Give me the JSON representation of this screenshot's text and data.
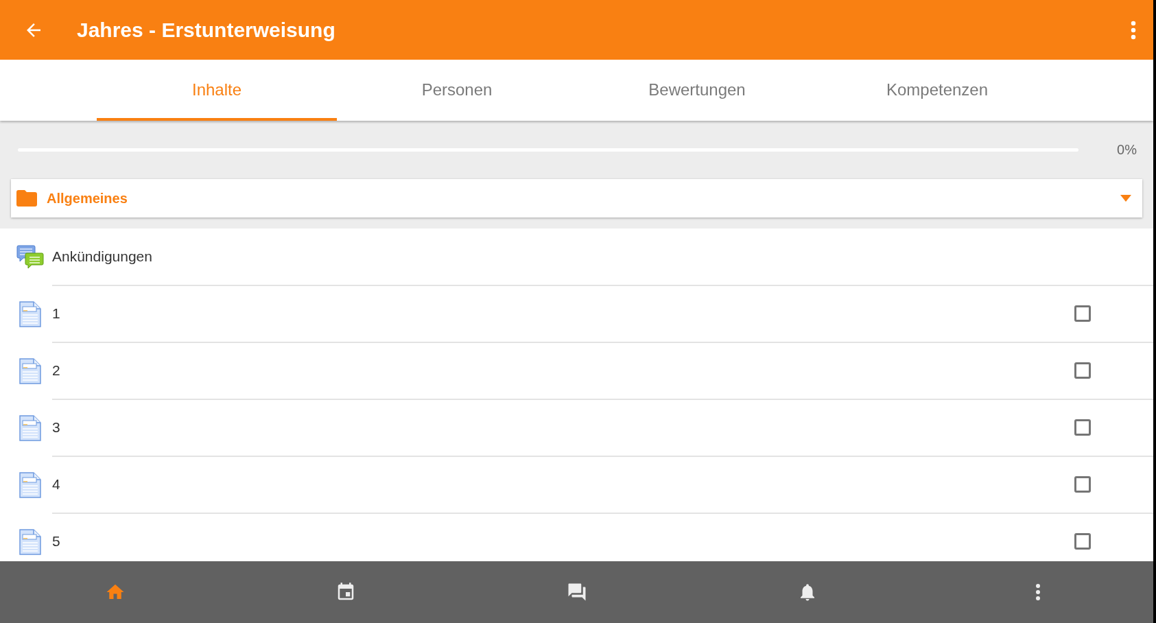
{
  "app_bar": {
    "title": "Jahres - Erstunterweisung"
  },
  "tabs": [
    {
      "label": "Inhalte",
      "selected": true
    },
    {
      "label": "Personen",
      "selected": false
    },
    {
      "label": "Bewertungen",
      "selected": false
    },
    {
      "label": "Kompetenzen",
      "selected": false
    }
  ],
  "progress": {
    "level": 0,
    "reading": "0%"
  },
  "section": {
    "title": "Allgemeines",
    "expanded": true
  },
  "items": [
    {
      "kind": "forum",
      "label": "Ankündigungen"
    },
    {
      "kind": "page",
      "label": "1",
      "checked": false
    },
    {
      "kind": "page",
      "label": "2",
      "checked": false
    },
    {
      "kind": "page",
      "label": "3",
      "checked": false
    },
    {
      "kind": "page",
      "label": "4",
      "checked": false
    },
    {
      "kind": "page",
      "label": "5",
      "checked": false
    }
  ],
  "bottom_nav": [
    {
      "kind": "home",
      "selected": true
    },
    {
      "kind": "calendar",
      "selected": false
    },
    {
      "kind": "messages",
      "selected": false
    },
    {
      "kind": "notifications",
      "selected": false
    },
    {
      "kind": "more",
      "selected": false
    }
  ]
}
